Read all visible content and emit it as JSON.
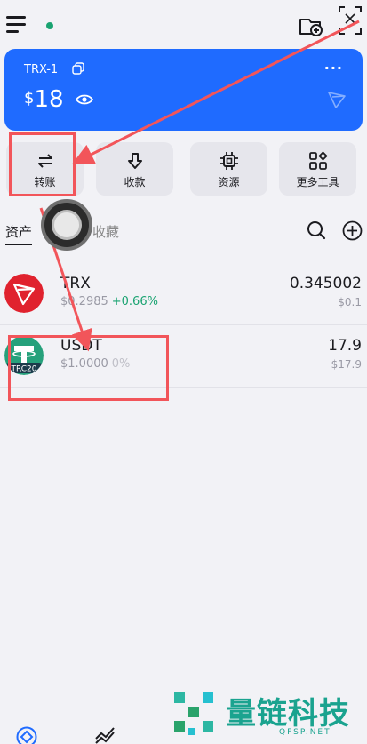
{
  "header": {
    "menu_icon": "hamburger-icon",
    "status_color": "#1aa371"
  },
  "wallet": {
    "name": "TRX-1",
    "currency_symbol": "$",
    "balance": "18",
    "more": "···",
    "card_color": "#1f6bff"
  },
  "actions": [
    {
      "label": "转账",
      "icon": "transfer-icon"
    },
    {
      "label": "收款",
      "icon": "receive-icon"
    },
    {
      "label": "资源",
      "icon": "chip-icon"
    },
    {
      "label": "更多工具",
      "icon": "grid-icon"
    }
  ],
  "tabs": {
    "assets": "资产",
    "second": "收藏"
  },
  "assets": [
    {
      "symbol": "TRX",
      "price": "$0.2985",
      "change": "+0.66%",
      "amount": "0.345002",
      "value": "$0.1"
    },
    {
      "symbol": "USDT",
      "price": "$1.0000",
      "change": "0%",
      "amount": "17.9",
      "value": "$17.9",
      "badge": "TRC20"
    }
  ],
  "watermark": {
    "title": "量链科技",
    "subtitle": "QFSP.NET"
  }
}
